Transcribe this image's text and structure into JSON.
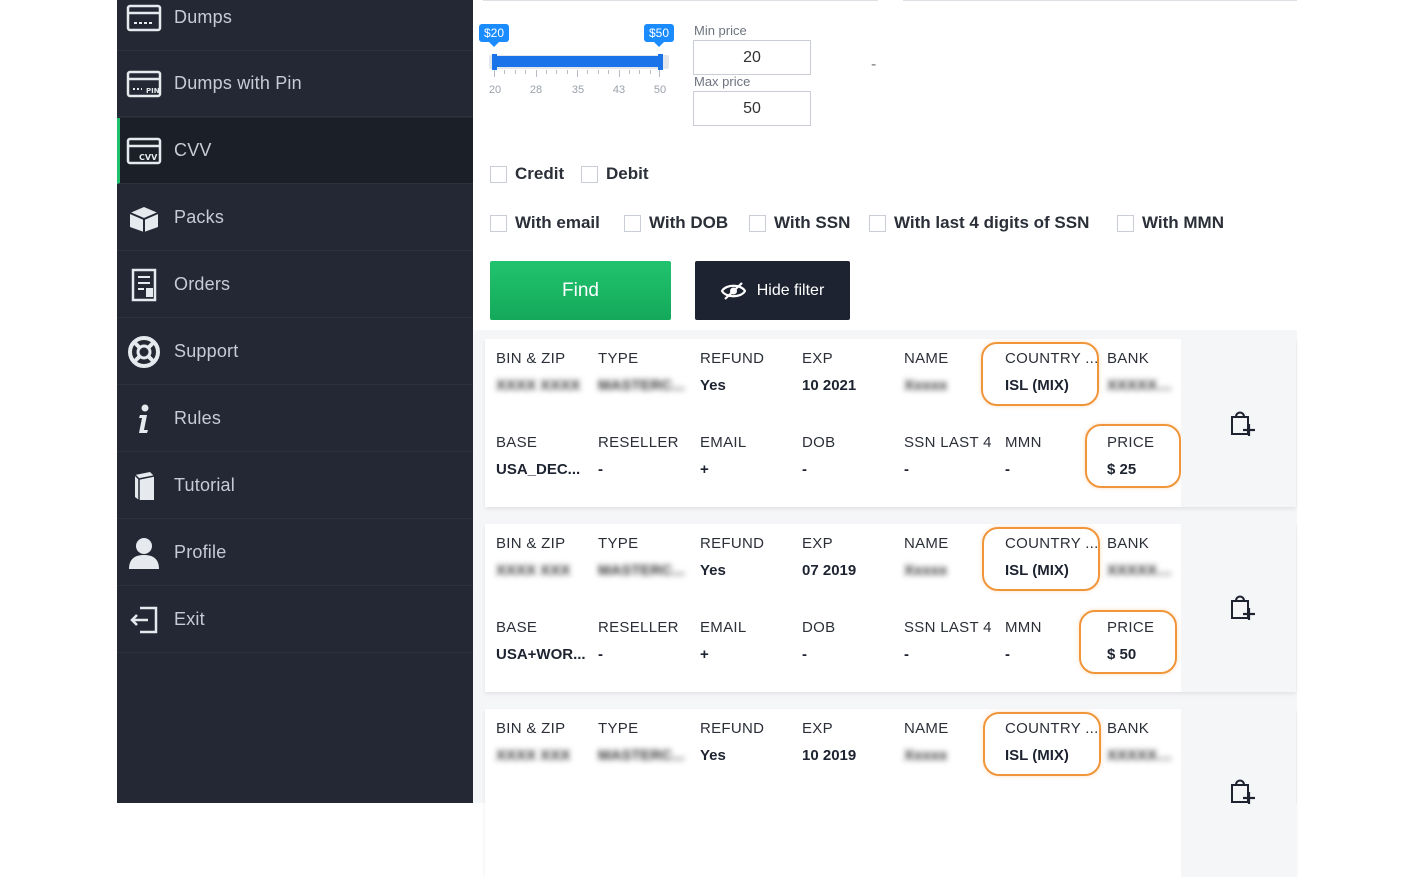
{
  "sidebar": {
    "items": [
      {
        "label": "Dumps",
        "icon": "card-dashes-icon"
      },
      {
        "label": "Dumps with Pin",
        "icon": "card-pin-icon"
      },
      {
        "label": "CVV",
        "icon": "card-cvv-icon"
      },
      {
        "label": "Packs",
        "icon": "box-icon"
      },
      {
        "label": "Orders",
        "icon": "receipt-icon"
      },
      {
        "label": "Support",
        "icon": "lifebuoy-icon"
      },
      {
        "label": "Rules",
        "icon": "info-icon"
      },
      {
        "label": "Tutorial",
        "icon": "book-icon"
      },
      {
        "label": "Profile",
        "icon": "user-icon"
      },
      {
        "label": "Exit",
        "icon": "exit-icon"
      }
    ],
    "active": "CVV"
  },
  "filter": {
    "slider": {
      "min_bubble": "$20",
      "max_bubble": "$50",
      "ticks": [
        "20",
        "28",
        "35",
        "43",
        "50"
      ],
      "min_value": 20,
      "max_value": 50
    },
    "min_price_label": "Min price",
    "min_price_value": "20",
    "max_price_label": "Max price",
    "max_price_value": "50",
    "dash": "-",
    "type_checks": [
      "Credit",
      "Debit"
    ],
    "extra_checks": [
      "With email",
      "With DOB",
      "With SSN",
      "With last 4 digits of SSN",
      "With MMN"
    ],
    "find_label": "Find",
    "hide_label": "Hide filter"
  },
  "headers": {
    "bin": "BIN & ZIP",
    "type": "TYPE",
    "refund": "REFUND",
    "exp": "EXP",
    "name": "NAME",
    "country": "COUNTRY ...",
    "bank": "BANK",
    "base": "BASE",
    "reseller": "RESELLER",
    "email": "EMAIL",
    "dob": "DOB",
    "ssn": "SSN LAST 4",
    "mmn": "MMN",
    "price": "PRICE"
  },
  "results": [
    {
      "bin": "XXXX XXXX",
      "type": "MASTERC...",
      "refund": "Yes",
      "exp": "10 2021",
      "name": "Xxxxx",
      "country": "ISL (MIX)",
      "bank": "XXXXXXX...",
      "base": "USA_DEC...",
      "reseller": "-",
      "email": "+",
      "dob": "-",
      "ssn": "-",
      "mmn": "-",
      "price": "$ 25"
    },
    {
      "bin": "XXXX XXX",
      "type": "MASTERC...",
      "refund": "Yes",
      "exp": "07 2019",
      "name": "Xxxxx",
      "country": "ISL (MIX)",
      "bank": "XXXXXXX...",
      "base": "USA+WOR...",
      "reseller": "-",
      "email": "+",
      "dob": "-",
      "ssn": "-",
      "mmn": "-",
      "price": "$ 50"
    },
    {
      "bin": "XXXX XXX",
      "type": "MASTERC...",
      "refund": "Yes",
      "exp": "10 2019",
      "name": "Xxxxx",
      "country": "ISL (MIX)",
      "bank": "XXXXXXX...",
      "base": "",
      "reseller": "",
      "email": "",
      "dob": "",
      "ssn": "",
      "mmn": "",
      "price": ""
    }
  ]
}
